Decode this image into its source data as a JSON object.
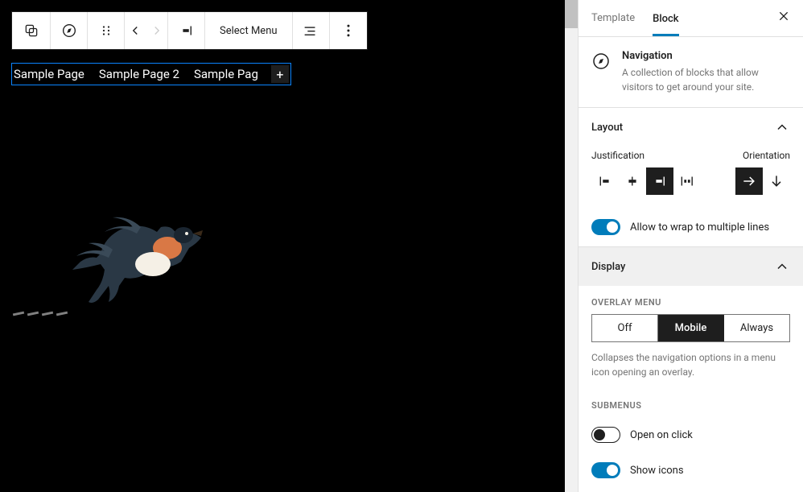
{
  "tabs": {
    "template": "Template",
    "block": "Block"
  },
  "block": {
    "title": "Navigation",
    "description": "A collection of blocks that allow visitors to get around your site."
  },
  "toolbar": {
    "select_menu": "Select Menu"
  },
  "nav": {
    "items": [
      "Sample Page",
      "Sample Page 2",
      "Sample Pag"
    ]
  },
  "layout": {
    "title": "Layout",
    "justification_label": "Justification",
    "orientation_label": "Orientation",
    "wrap_label": "Allow to wrap to multiple lines"
  },
  "display": {
    "title": "Display",
    "overlay_label": "OVERLAY MENU",
    "overlay_options": [
      "Off",
      "Mobile",
      "Always"
    ],
    "overlay_help": "Collapses the navigation options in a menu icon opening an overlay.",
    "submenus_label": "SUBMENUS",
    "open_on_click": "Open on click",
    "show_icons": "Show icons"
  }
}
